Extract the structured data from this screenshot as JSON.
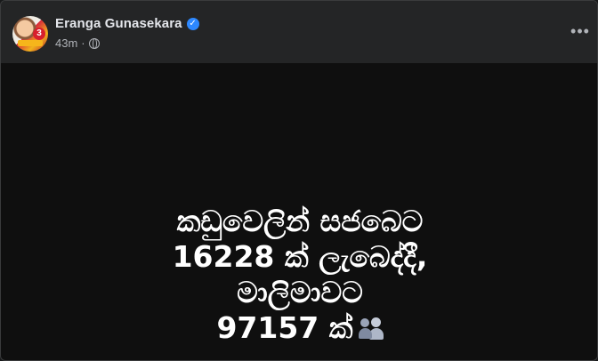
{
  "post": {
    "author_name": "Eranga Gunasekara",
    "timestamp": "43m",
    "separator": "·",
    "verified": true,
    "avatar_badge": "3",
    "privacy_icon": "globe-icon",
    "more_label": "•••"
  },
  "content": {
    "lines": [
      "කඩුවෙලින් සජබෙට",
      "16228 ක් ලැබෙද්දී,",
      "මාලිමාවට",
      "97157 ක්"
    ],
    "emoji_icon": "busts-in-silhouette-icon"
  },
  "colors": {
    "post_bg": "#242526",
    "media_bg": "#0f0f0f",
    "primary_text": "#e4e6eb",
    "secondary_text": "#b0b3b8",
    "verified_blue": "#2d88ff"
  }
}
